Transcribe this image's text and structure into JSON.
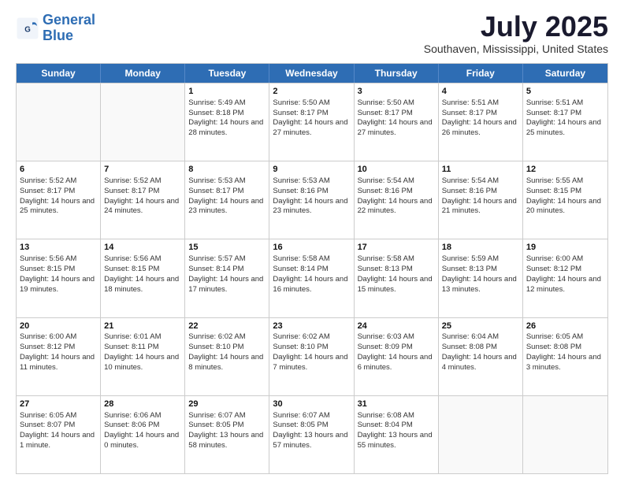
{
  "header": {
    "logo_general": "General",
    "logo_blue": "Blue",
    "month_year": "July 2025",
    "location": "Southaven, Mississippi, United States"
  },
  "days_of_week": [
    "Sunday",
    "Monday",
    "Tuesday",
    "Wednesday",
    "Thursday",
    "Friday",
    "Saturday"
  ],
  "weeks": [
    [
      {
        "day": "",
        "sunrise": "",
        "sunset": "",
        "daylight": ""
      },
      {
        "day": "",
        "sunrise": "",
        "sunset": "",
        "daylight": ""
      },
      {
        "day": "1",
        "sunrise": "Sunrise: 5:49 AM",
        "sunset": "Sunset: 8:18 PM",
        "daylight": "Daylight: 14 hours and 28 minutes."
      },
      {
        "day": "2",
        "sunrise": "Sunrise: 5:50 AM",
        "sunset": "Sunset: 8:17 PM",
        "daylight": "Daylight: 14 hours and 27 minutes."
      },
      {
        "day": "3",
        "sunrise": "Sunrise: 5:50 AM",
        "sunset": "Sunset: 8:17 PM",
        "daylight": "Daylight: 14 hours and 27 minutes."
      },
      {
        "day": "4",
        "sunrise": "Sunrise: 5:51 AM",
        "sunset": "Sunset: 8:17 PM",
        "daylight": "Daylight: 14 hours and 26 minutes."
      },
      {
        "day": "5",
        "sunrise": "Sunrise: 5:51 AM",
        "sunset": "Sunset: 8:17 PM",
        "daylight": "Daylight: 14 hours and 25 minutes."
      }
    ],
    [
      {
        "day": "6",
        "sunrise": "Sunrise: 5:52 AM",
        "sunset": "Sunset: 8:17 PM",
        "daylight": "Daylight: 14 hours and 25 minutes."
      },
      {
        "day": "7",
        "sunrise": "Sunrise: 5:52 AM",
        "sunset": "Sunset: 8:17 PM",
        "daylight": "Daylight: 14 hours and 24 minutes."
      },
      {
        "day": "8",
        "sunrise": "Sunrise: 5:53 AM",
        "sunset": "Sunset: 8:17 PM",
        "daylight": "Daylight: 14 hours and 23 minutes."
      },
      {
        "day": "9",
        "sunrise": "Sunrise: 5:53 AM",
        "sunset": "Sunset: 8:16 PM",
        "daylight": "Daylight: 14 hours and 23 minutes."
      },
      {
        "day": "10",
        "sunrise": "Sunrise: 5:54 AM",
        "sunset": "Sunset: 8:16 PM",
        "daylight": "Daylight: 14 hours and 22 minutes."
      },
      {
        "day": "11",
        "sunrise": "Sunrise: 5:54 AM",
        "sunset": "Sunset: 8:16 PM",
        "daylight": "Daylight: 14 hours and 21 minutes."
      },
      {
        "day": "12",
        "sunrise": "Sunrise: 5:55 AM",
        "sunset": "Sunset: 8:15 PM",
        "daylight": "Daylight: 14 hours and 20 minutes."
      }
    ],
    [
      {
        "day": "13",
        "sunrise": "Sunrise: 5:56 AM",
        "sunset": "Sunset: 8:15 PM",
        "daylight": "Daylight: 14 hours and 19 minutes."
      },
      {
        "day": "14",
        "sunrise": "Sunrise: 5:56 AM",
        "sunset": "Sunset: 8:15 PM",
        "daylight": "Daylight: 14 hours and 18 minutes."
      },
      {
        "day": "15",
        "sunrise": "Sunrise: 5:57 AM",
        "sunset": "Sunset: 8:14 PM",
        "daylight": "Daylight: 14 hours and 17 minutes."
      },
      {
        "day": "16",
        "sunrise": "Sunrise: 5:58 AM",
        "sunset": "Sunset: 8:14 PM",
        "daylight": "Daylight: 14 hours and 16 minutes."
      },
      {
        "day": "17",
        "sunrise": "Sunrise: 5:58 AM",
        "sunset": "Sunset: 8:13 PM",
        "daylight": "Daylight: 14 hours and 15 minutes."
      },
      {
        "day": "18",
        "sunrise": "Sunrise: 5:59 AM",
        "sunset": "Sunset: 8:13 PM",
        "daylight": "Daylight: 14 hours and 13 minutes."
      },
      {
        "day": "19",
        "sunrise": "Sunrise: 6:00 AM",
        "sunset": "Sunset: 8:12 PM",
        "daylight": "Daylight: 14 hours and 12 minutes."
      }
    ],
    [
      {
        "day": "20",
        "sunrise": "Sunrise: 6:00 AM",
        "sunset": "Sunset: 8:12 PM",
        "daylight": "Daylight: 14 hours and 11 minutes."
      },
      {
        "day": "21",
        "sunrise": "Sunrise: 6:01 AM",
        "sunset": "Sunset: 8:11 PM",
        "daylight": "Daylight: 14 hours and 10 minutes."
      },
      {
        "day": "22",
        "sunrise": "Sunrise: 6:02 AM",
        "sunset": "Sunset: 8:10 PM",
        "daylight": "Daylight: 14 hours and 8 minutes."
      },
      {
        "day": "23",
        "sunrise": "Sunrise: 6:02 AM",
        "sunset": "Sunset: 8:10 PM",
        "daylight": "Daylight: 14 hours and 7 minutes."
      },
      {
        "day": "24",
        "sunrise": "Sunrise: 6:03 AM",
        "sunset": "Sunset: 8:09 PM",
        "daylight": "Daylight: 14 hours and 6 minutes."
      },
      {
        "day": "25",
        "sunrise": "Sunrise: 6:04 AM",
        "sunset": "Sunset: 8:08 PM",
        "daylight": "Daylight: 14 hours and 4 minutes."
      },
      {
        "day": "26",
        "sunrise": "Sunrise: 6:05 AM",
        "sunset": "Sunset: 8:08 PM",
        "daylight": "Daylight: 14 hours and 3 minutes."
      }
    ],
    [
      {
        "day": "27",
        "sunrise": "Sunrise: 6:05 AM",
        "sunset": "Sunset: 8:07 PM",
        "daylight": "Daylight: 14 hours and 1 minute."
      },
      {
        "day": "28",
        "sunrise": "Sunrise: 6:06 AM",
        "sunset": "Sunset: 8:06 PM",
        "daylight": "Daylight: 14 hours and 0 minutes."
      },
      {
        "day": "29",
        "sunrise": "Sunrise: 6:07 AM",
        "sunset": "Sunset: 8:05 PM",
        "daylight": "Daylight: 13 hours and 58 minutes."
      },
      {
        "day": "30",
        "sunrise": "Sunrise: 6:07 AM",
        "sunset": "Sunset: 8:05 PM",
        "daylight": "Daylight: 13 hours and 57 minutes."
      },
      {
        "day": "31",
        "sunrise": "Sunrise: 6:08 AM",
        "sunset": "Sunset: 8:04 PM",
        "daylight": "Daylight: 13 hours and 55 minutes."
      },
      {
        "day": "",
        "sunrise": "",
        "sunset": "",
        "daylight": ""
      },
      {
        "day": "",
        "sunrise": "",
        "sunset": "",
        "daylight": ""
      }
    ]
  ]
}
